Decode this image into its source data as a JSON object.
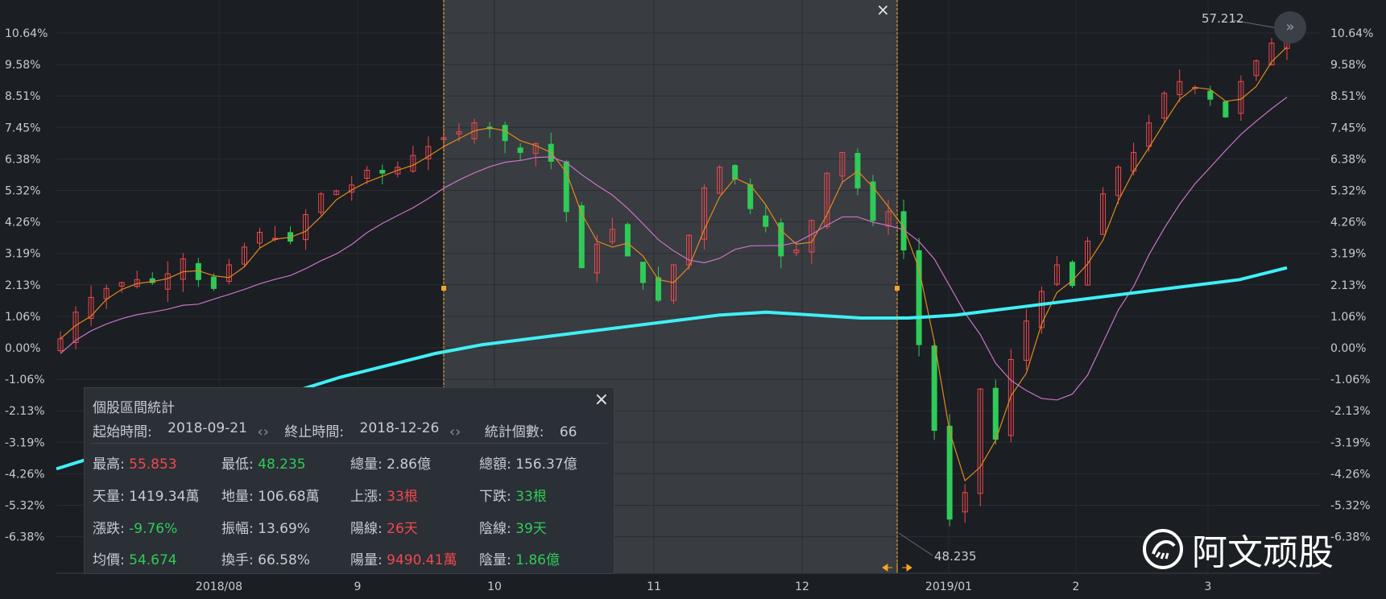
{
  "chart_data": {
    "type": "candlestick",
    "y_axis_ticks": [
      "10.64%",
      "9.58%",
      "8.51%",
      "7.45%",
      "6.38%",
      "5.32%",
      "4.26%",
      "3.19%",
      "2.13%",
      "1.06%",
      "0.00%",
      "-1.06%",
      "-2.13%",
      "-3.19%",
      "-4.26%",
      "-5.32%",
      "-6.38%"
    ],
    "y_axis_ticks_right_last": "-6.38%",
    "ylim": [
      -6.9,
      11.0
    ],
    "x_axis_ticks": [
      "2018/08",
      "9",
      "10",
      "11",
      "12",
      "2019/01",
      "2",
      "3"
    ],
    "annotations": {
      "high_label": "57.212",
      "low_label": "48.235"
    },
    "series": [
      {
        "type": "candles",
        "values_pct": [
          0.3,
          1.2,
          1.7,
          2.0,
          2.2,
          2.3,
          2.2,
          2.5,
          3.0,
          2.3,
          2.0,
          2.8,
          3.4,
          3.9,
          3.7,
          3.6,
          4.5,
          5.2,
          5.3,
          5.5,
          6.0,
          5.9,
          6.1,
          6.5,
          6.8,
          7.1,
          7.3,
          7.6,
          7.4,
          7.0,
          6.6,
          6.9,
          6.3,
          4.6,
          2.7,
          3.5,
          4.0,
          3.1,
          2.2,
          1.6,
          2.8,
          3.8,
          5.4,
          6.1,
          5.7,
          4.7,
          4.1,
          3.1,
          3.3,
          4.3,
          5.9,
          6.6,
          5.4,
          4.3,
          4.6,
          3.3,
          0.1,
          -2.8,
          -5.8,
          -4.9,
          -1.4,
          -3.1,
          -0.4,
          0.9,
          1.9,
          2.8,
          2.1,
          3.6,
          5.2,
          6.1,
          6.6,
          7.6,
          8.6,
          9.0,
          8.8,
          8.4,
          7.8,
          9.0,
          9.7,
          10.3,
          10.5
        ]
      },
      {
        "type": "ma5",
        "color": "#e08a1e"
      },
      {
        "type": "ma20",
        "color": "#c874c8"
      },
      {
        "type": "ma250",
        "color": "#3ef0f5",
        "values_pct": [
          -4.1,
          -3.6,
          -3.1,
          -2.6,
          -2.1,
          -1.5,
          -1.0,
          -0.6,
          -0.2,
          0.1,
          0.3,
          0.5,
          0.7,
          0.9,
          1.1,
          1.2,
          1.1,
          1.0,
          1.0,
          1.1,
          1.3,
          1.5,
          1.7,
          1.9,
          2.1,
          2.3,
          2.7
        ]
      }
    ]
  },
  "range_selection": {
    "close": "×"
  },
  "stats_panel": {
    "title": "個股區間統計",
    "close": "×",
    "start_label": "起始時間:",
    "start_value": "2018-09-21",
    "end_label": "終止時間:",
    "end_value": "2018-12-26",
    "count_label": "統計個數:",
    "count_value": "66",
    "cells": [
      {
        "label": "最高: ",
        "value": "55.853",
        "color": "red"
      },
      {
        "label": "最低: ",
        "value": "48.235",
        "color": "green"
      },
      {
        "label": "總量: ",
        "value": "2.86億",
        "color": "none"
      },
      {
        "label": "總額: ",
        "value": "156.37億",
        "color": "none"
      },
      {
        "label": "天量: ",
        "value": "1419.34萬",
        "color": "none"
      },
      {
        "label": "地量: ",
        "value": "106.68萬",
        "color": "none"
      },
      {
        "label": "上漲: ",
        "value": "33根",
        "color": "red"
      },
      {
        "label": "下跌: ",
        "value": "33根",
        "color": "green"
      },
      {
        "label": "漲跌: ",
        "value": "-9.76%",
        "color": "green"
      },
      {
        "label": "振幅: ",
        "value": "13.69%",
        "color": "none"
      },
      {
        "label": "陽線: ",
        "value": "26天",
        "color": "red"
      },
      {
        "label": "陰線: ",
        "value": "39天",
        "color": "green"
      },
      {
        "label": "均價: ",
        "value": "54.674",
        "color": "green"
      },
      {
        "label": "換手: ",
        "value": "66.58%",
        "color": "none"
      },
      {
        "label": "陽量: ",
        "value": "9490.41萬",
        "color": "red"
      },
      {
        "label": "陰量: ",
        "value": "1.86億",
        "color": "green"
      }
    ]
  },
  "watermark": {
    "text": "阿文顽股"
  },
  "colors": {
    "up": "#f0484d",
    "down": "#2fcb58",
    "range_line": "#f5a623",
    "shade": "#3a3d42"
  }
}
